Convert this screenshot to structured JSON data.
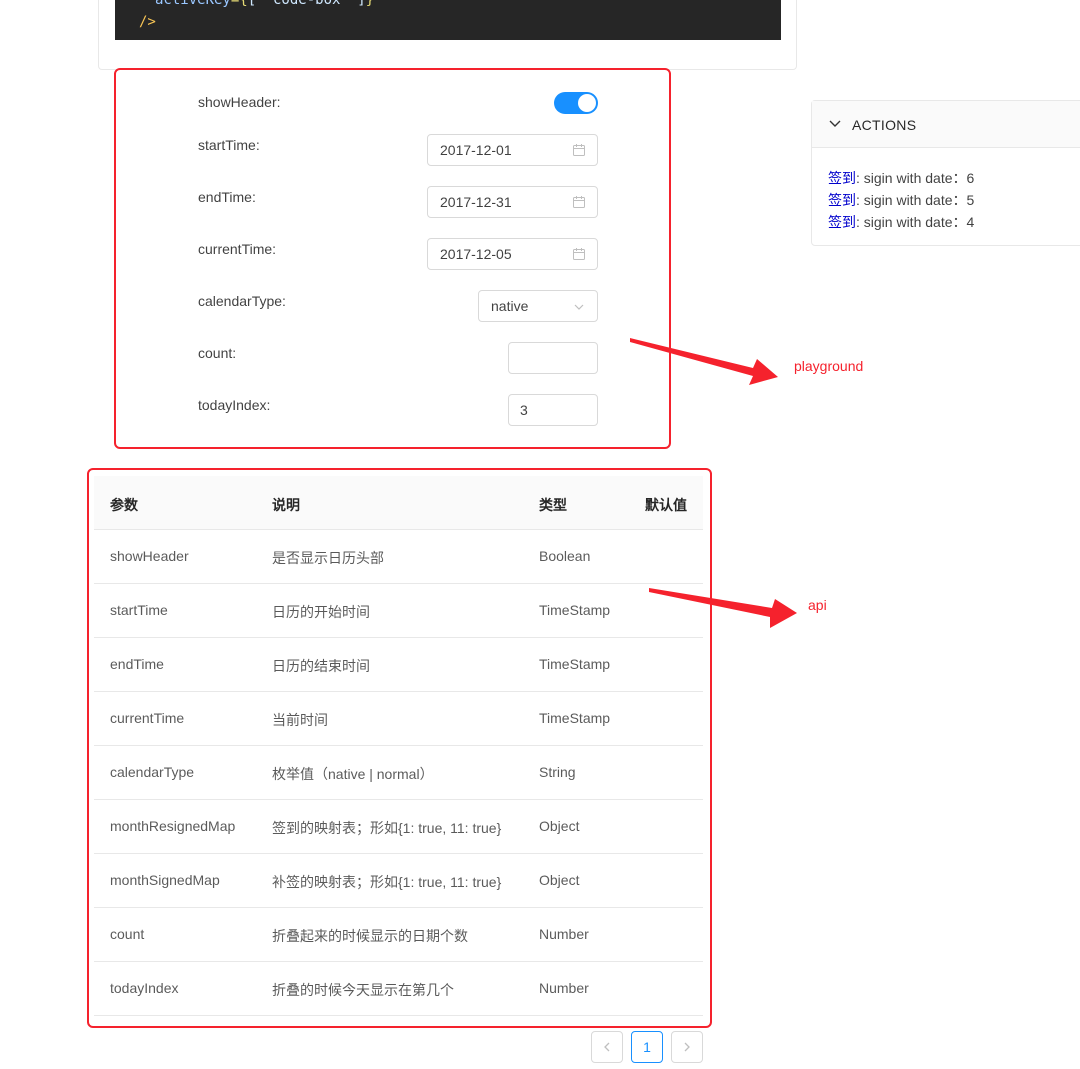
{
  "code": {
    "line1_key": "activeKey",
    "line1_eq": "={",
    "line1_val": "[ 'code-box' ]",
    "line1_end": "}",
    "line2": "/>"
  },
  "playground": {
    "annotation": "playground",
    "show_header": {
      "label": "showHeader:",
      "checked": true
    },
    "start_time": {
      "label": "startTime:",
      "value": "2017-12-01"
    },
    "end_time": {
      "label": "endTime:",
      "value": "2017-12-31"
    },
    "current_time": {
      "label": "currentTime:",
      "value": "2017-12-05"
    },
    "calendar_type": {
      "label": "calendarType:",
      "value": "native"
    },
    "count": {
      "label": "count:",
      "value": ""
    },
    "today_index": {
      "label": "todayIndex:",
      "value": "3"
    }
  },
  "actions": {
    "title": "ACTIONS",
    "logs": [
      {
        "name": "签到",
        "text": ": sigin with date：6"
      },
      {
        "name": "签到",
        "text": ": sigin with date：5"
      },
      {
        "name": "签到",
        "text": ": sigin with date：4"
      }
    ]
  },
  "api": {
    "annotation": "api",
    "columns": [
      "参数",
      "说明",
      "类型",
      "默认值"
    ],
    "rows": [
      [
        "showHeader",
        "是否显示日历头部",
        "Boolean",
        ""
      ],
      [
        "startTime",
        "日历的开始时间",
        "TimeStamp",
        ""
      ],
      [
        "endTime",
        "日历的结束时间",
        "TimeStamp",
        ""
      ],
      [
        "currentTime",
        "当前时间",
        "TimeStamp",
        ""
      ],
      [
        "calendarType",
        "枚举值（native | normal）",
        "String",
        ""
      ],
      [
        "monthResignedMap",
        "签到的映射表；形如{1: true, 11: true}",
        "Object",
        ""
      ],
      [
        "monthSignedMap",
        "补签的映射表；形如{1: true, 11: true}",
        "Object",
        ""
      ],
      [
        "count",
        "折叠起来的时候显示的日期个数",
        "Number",
        ""
      ],
      [
        "todayIndex",
        "折叠的时候今天显示在第几个",
        "Number",
        ""
      ]
    ]
  },
  "pagination": {
    "current": "1"
  },
  "colors": {
    "primary": "#1890ff",
    "annotation": "#f5222d",
    "log_name": "#0000cc"
  }
}
